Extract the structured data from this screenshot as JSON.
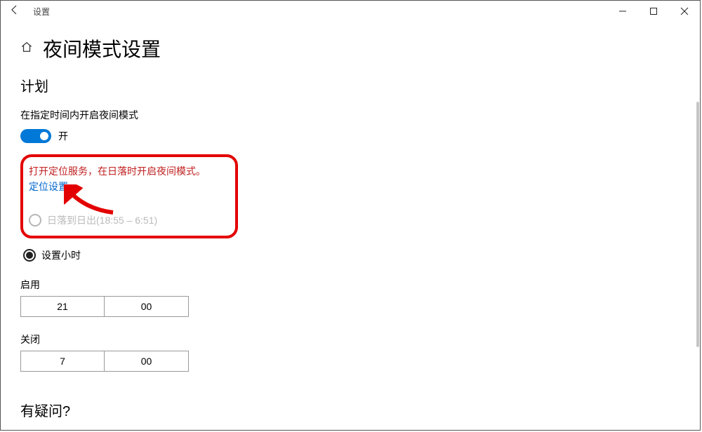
{
  "titlebar": {
    "title": "设置"
  },
  "page": {
    "title": "夜间模式设置",
    "plan_heading": "计划",
    "schedule_text": "在指定时间内开启夜间模式",
    "toggle_state": "开",
    "warning_text": "打开定位服务，在日落时开启夜间模式。",
    "location_link": "定位设置",
    "radio_sunset": "日落到日出(18:55 – 6:51)",
    "radio_hours": "设置小时",
    "enable_label": "启用",
    "enable_hour": "21",
    "enable_minute": "00",
    "disable_label": "关闭",
    "disable_hour": "7",
    "disable_minute": "00",
    "question": "有疑问?"
  }
}
